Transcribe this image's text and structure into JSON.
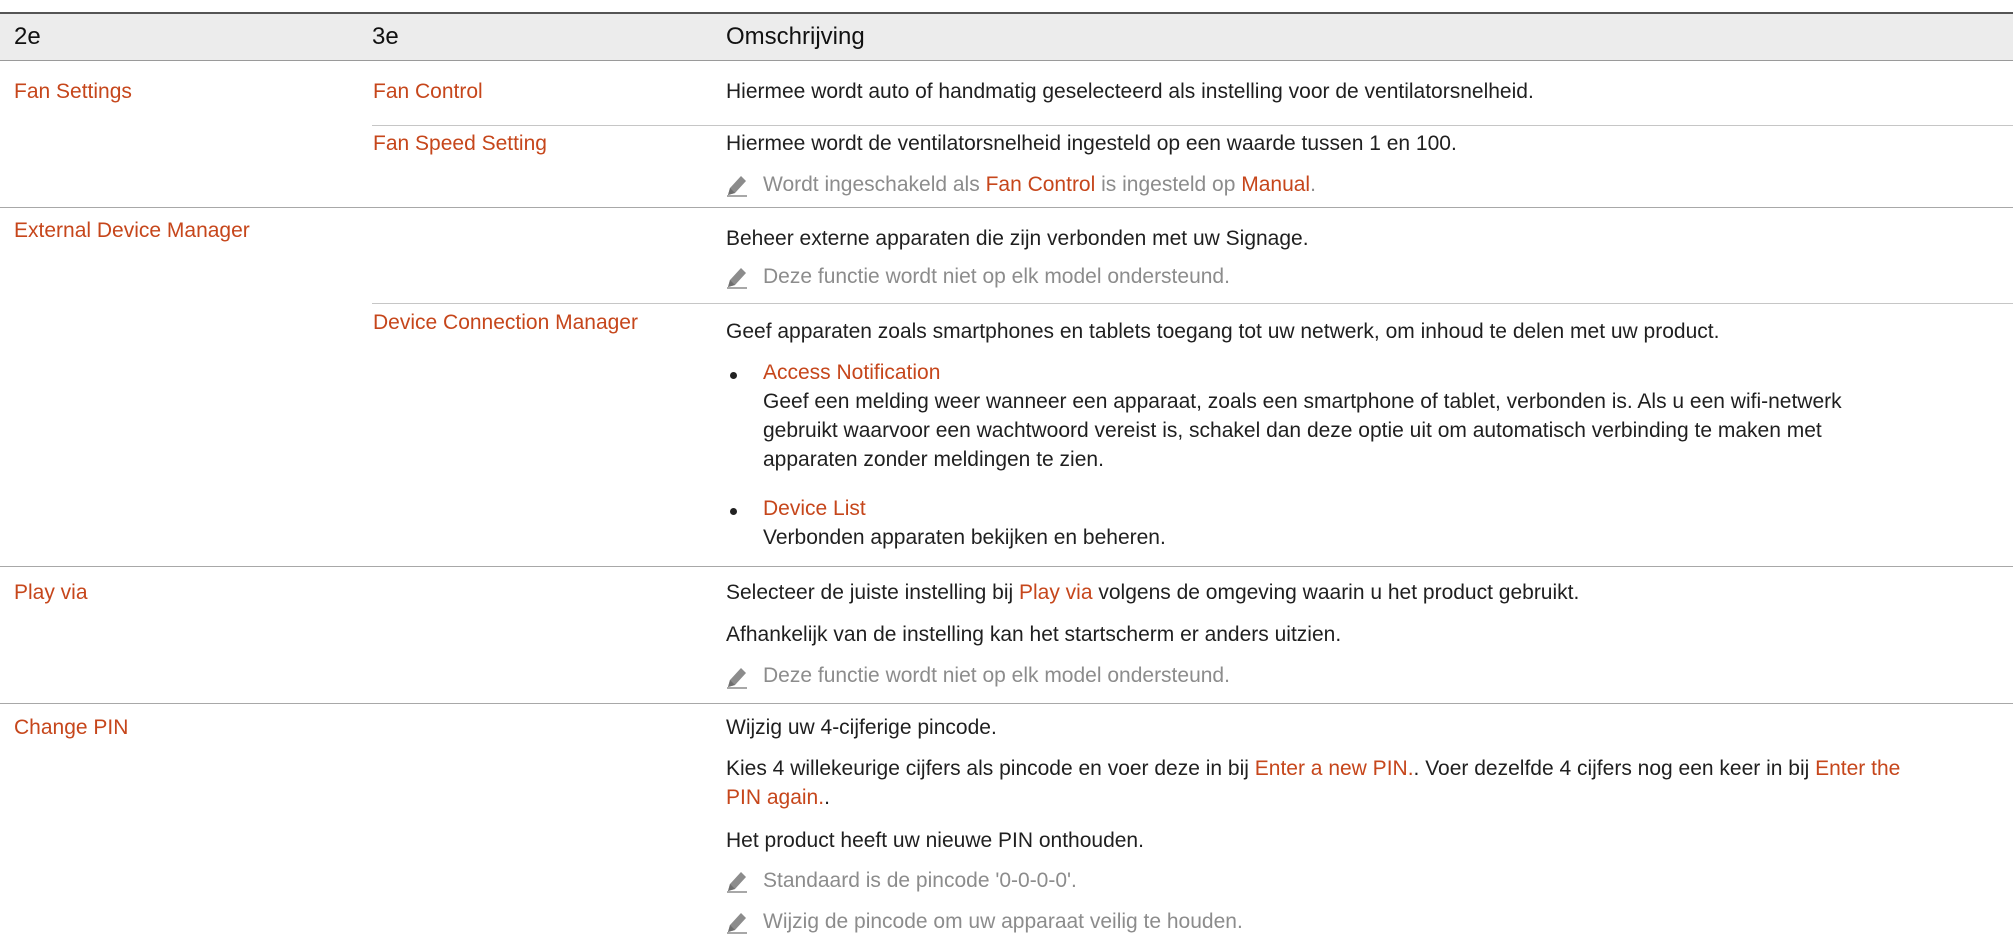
{
  "colors": {
    "accent": "#c6461b",
    "note_gray": "#8c8c8c",
    "header_bg": "#ececec"
  },
  "header": {
    "col2": "2e",
    "col3": "3e",
    "col4": "Omschrijving"
  },
  "rows": {
    "fan": {
      "col2": "Fan Settings",
      "sub1": {
        "col3": "Fan Control",
        "desc": "Hiermee wordt auto of handmatig geselecteerd als instelling voor de ventilatorsnelheid."
      },
      "sub2": {
        "col3": "Fan Speed Setting",
        "desc": "Hiermee wordt de ventilatorsnelheid ingesteld op een waarde tussen 1 en 100.",
        "note": {
          "p1": "Wordt ingeschakeld als ",
          "h1": "Fan Control",
          "p2": " is ingesteld op ",
          "h2": "Manual",
          "p3": "."
        }
      }
    },
    "edm": {
      "col2": "External Device Manager",
      "desc": "Beheer externe apparaten die zijn verbonden met uw Signage.",
      "note": "Deze functie wordt niet op elk model ondersteund.",
      "sub": {
        "col3": "Device Connection Manager",
        "desc": "Geef apparaten zoals smartphones en tablets toegang tot uw netwerk, om inhoud te delen met uw product.",
        "bullet1": {
          "title": "Access Notification",
          "line1": "Geef een melding weer wanneer een apparaat, zoals een smartphone of tablet, verbonden is. Als u een wifi-netwerk",
          "line2": "gebruikt waarvoor een wachtwoord vereist is, schakel dan deze optie uit om automatisch verbinding te maken met",
          "line3": "apparaten zonder meldingen te zien."
        },
        "bullet2": {
          "title": "Device List",
          "text": "Verbonden apparaten bekijken en beheren."
        }
      }
    },
    "play": {
      "col2": "Play via",
      "desc1": {
        "p1": "Selecteer de juiste instelling bij ",
        "h1": "Play via",
        "p2": " volgens de omgeving waarin u het product gebruikt."
      },
      "desc2": "Afhankelijk van de instelling kan het startscherm er anders uitzien.",
      "note": "Deze functie wordt niet op elk model ondersteund."
    },
    "pin": {
      "col2": "Change PIN",
      "desc1": "Wijzig uw 4-cijferige pincode.",
      "desc2": {
        "p1": "Kies 4 willekeurige cijfers als pincode en voer deze in bij ",
        "h1": "Enter a new PIN.",
        "p2": ". Voer dezelfde 4 cijfers nog een keer in bij ",
        "h2": "Enter the",
        "h3": "PIN again.",
        "p3": "."
      },
      "desc3": "Het product heeft uw nieuwe PIN onthouden.",
      "note1": "Standaard is de pincode '0-0-0-0'.",
      "note2": "Wijzig de pincode om uw apparaat veilig te houden."
    }
  }
}
